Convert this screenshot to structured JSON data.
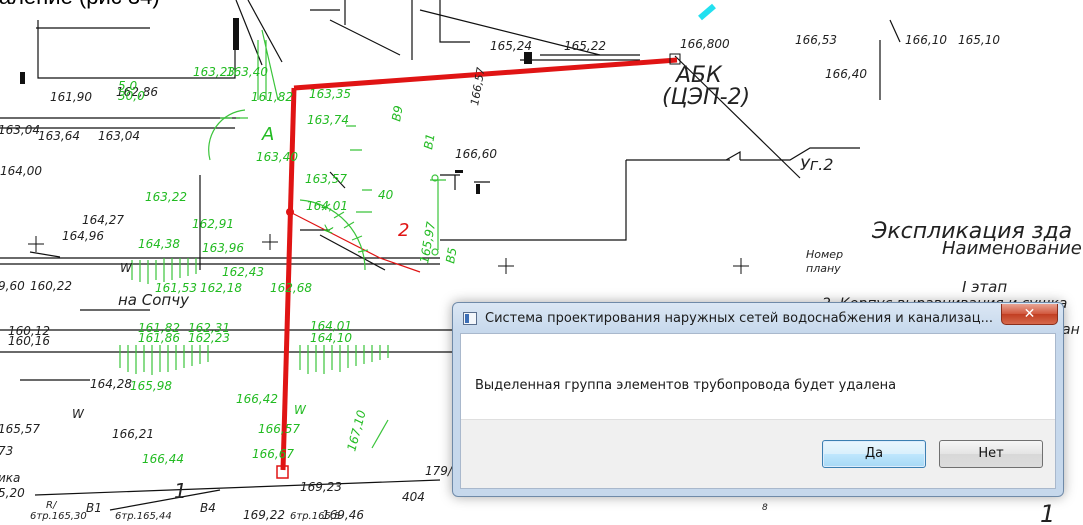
{
  "slide_title": "даление (рис 34)",
  "drawing": {
    "labels_black": [
      "161,90",
      "162,86",
      "163,04",
      "163,64",
      "163,04",
      "164,00",
      "164,27",
      "164,96",
      "9,60",
      "160,22",
      "160,12",
      "160,16",
      "164,28",
      "165,57",
      "166,21",
      "5,20",
      "166,53",
      "166,10",
      "165,10",
      "166,40",
      "165,24",
      "165,22",
      "166,800",
      "166,60",
      "169,23",
      "169,22",
      "179/18",
      "404",
      "6тр.165,30",
      "B1",
      "6тр.165,44",
      "B4",
      "6тр.165,5",
      "169,46",
      "на Сопчу",
      "W",
      "W",
      "73",
      "ика",
      "R/"
    ],
    "labels_green": [
      "163,23",
      "163,40",
      "161,82",
      "163,35",
      "163,74",
      "163,57",
      "163,40",
      "164,01",
      "163,22",
      "162,91",
      "164,38",
      "163,96",
      "161,53",
      "162,18",
      "162,43",
      "162,68",
      "161,82",
      "161,86",
      "162,31",
      "162,23",
      "164,01",
      "164,10",
      "165,98",
      "166,42",
      "166,57",
      "166,44",
      "166,67",
      "167,10",
      "165,97",
      "40",
      "5,0",
      "30,0",
      "A",
      "B1",
      "B9",
      "B5",
      "K",
      "W"
    ],
    "building_label": "АБК",
    "building_sub": "(ЦЭП-2)",
    "node_label": "Уг.2",
    "marker_2": "2",
    "explication_title": "Экспликация зда",
    "col_name": "Наименование",
    "col_num_1": "Номер",
    "col_num_2": "плану",
    "stage": "I этап",
    "stage_item": "2. Корпус выравнивания и сушка",
    "stage_item_tail": "ан",
    "bottom_mark": "1",
    "bottom_mark_2": "1",
    "label_166_57": "166,57",
    "label_8": "8"
  },
  "dialog": {
    "title": "Система проектирования наружных сетей водоснабжения и канализац...",
    "close_glyph": "✕",
    "message": "Выделенная группа элементов трубопровода будет удалена",
    "yes_label": "Да",
    "no_label": "Нет"
  }
}
